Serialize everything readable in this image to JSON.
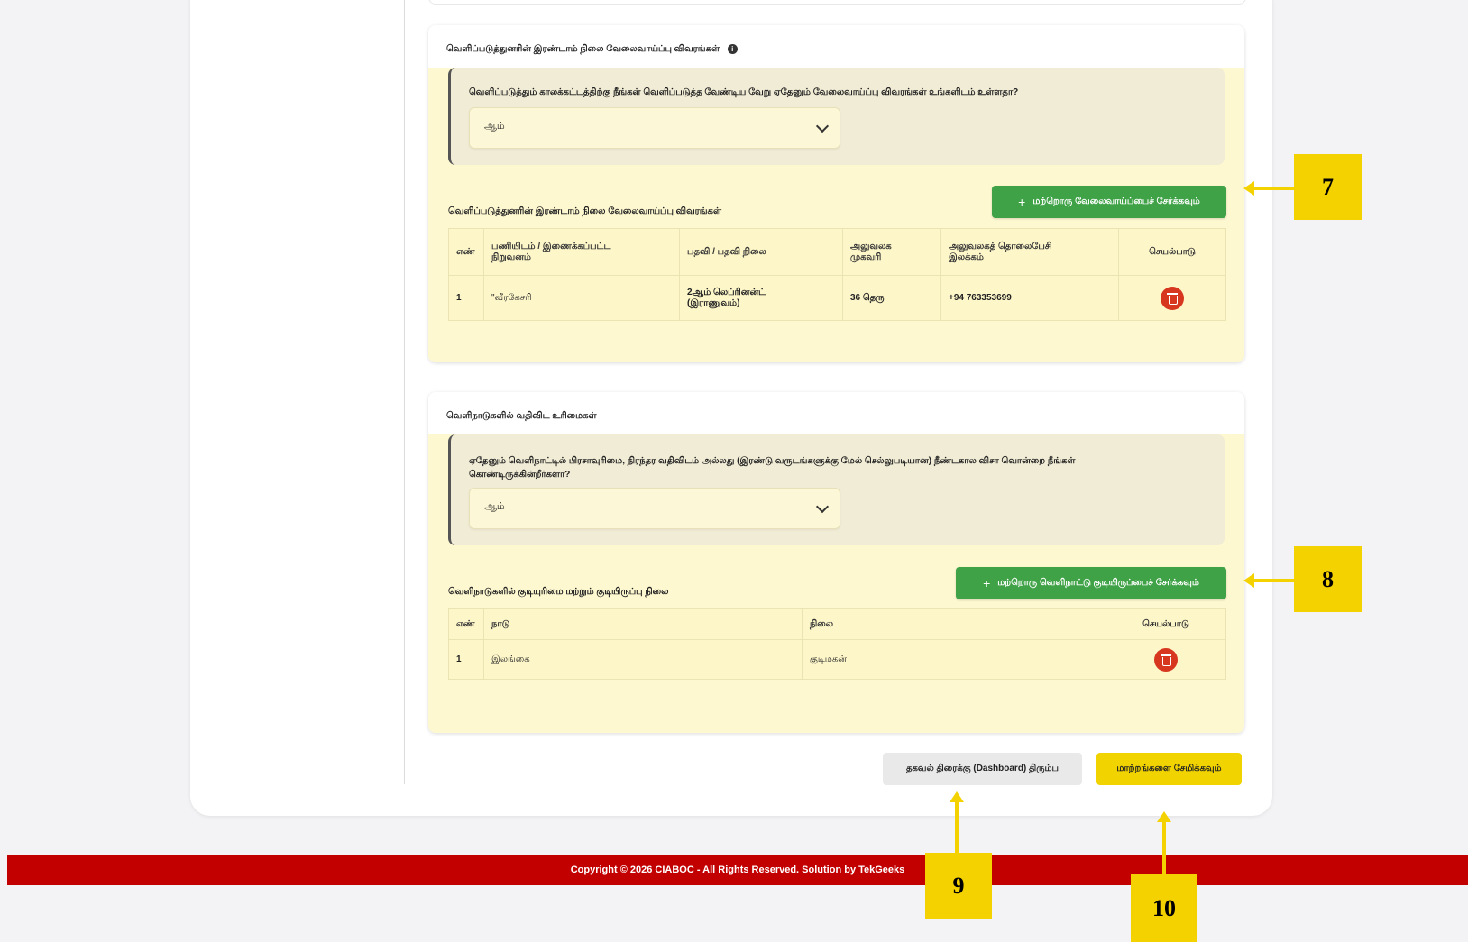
{
  "section1": {
    "title": "வெளிப்படுத்துனரின் இரண்டாம் நிலை வேலைவாய்ப்பு விவரங்கள்",
    "question": "வெளிப்படுத்தும் காலக்கட்டத்திற்கு நீங்கள் வெளிப்படுத்த வேண்டிய வேறு ஏதேனும் வேலைவாய்ப்பு விவரங்கள் உங்களிடம் உள்ளதா?",
    "select_value": "ஆம்",
    "add_button": "மற்றொரு வேலைவாய்ப்பைச் சேர்க்கவும்",
    "table_label": "வெளிப்படுத்துனரின் இரண்டாம் நிலை வேலைவாய்ப்பு விவரங்கள்",
    "headers": {
      "no": "எண்",
      "workplace_line1": "பணியிடம் / இணைக்கப்பட்ட",
      "workplace_line2": "நிறுவனம்",
      "position": "பதவி / பதவி நிலை",
      "address_line1": "அலுவலக",
      "address_line2": "முகவரி",
      "phone_line1": "அலுவலகத் தொலைபேசி",
      "phone_line2": "இலக்கம்",
      "action": "செயல்பாடு"
    },
    "rows": [
      {
        "no": "1",
        "workplace": "\"வீரகேசரி",
        "position_line1": "2ஆம் லெப்ரினன்ட்",
        "position_line2": "(இராணுவம்)",
        "address": "36 தெரு",
        "phone": "+94 763353699"
      }
    ]
  },
  "section2": {
    "title": "வெளிநாடுகளில் வதிவிட உரிமைகள்",
    "question_line1": "ஏதேனும் வெளிநாட்டில் பிரசாவுரிமை, நிரந்தர வதிவிடம் அல்லது (இரண்டு வருடங்களுக்கு மேல் செல்லுபடியான) நீண்டகால விசா வொன்றை நீங்கள்",
    "question_line2": "கொண்டிருக்கின்றீர்களா?",
    "select_value": "ஆம்",
    "add_button": "மற்றொரு வெளிநாட்டு குடியிருப்பைச் சேர்க்கவும்",
    "table_label": "வெளிநாடுகளில் குடியுரிமை மற்றும் குடியிருப்பு நிலை",
    "headers": {
      "no": "எண்",
      "country": "நாடு",
      "status": "நிலை",
      "action": "செயல்பாடு"
    },
    "rows": [
      {
        "no": "1",
        "country": "இலங்கை",
        "status": "குடிமகன்"
      }
    ]
  },
  "buttons": {
    "dashboard": "தகவல் திரைக்கு (Dashboard) திரும்ப",
    "save": "மாற்றங்களை சேமிக்கவும்"
  },
  "footer": "Copyright © 2026 CIABOC - All Rights Reserved. Solution by TekGeeks",
  "callouts": {
    "c7": "7",
    "c8": "8",
    "c9": "9",
    "c10": "10"
  },
  "icons": {
    "info": "info-icon",
    "trash": "trash-icon",
    "chevron": "chevron-down-icon",
    "plus": "plus-icon"
  },
  "colors": {
    "primary_green": "#3fa247",
    "save_yellow": "#f1d300",
    "footer_red": "#c30000",
    "delete_red": "#d7361f",
    "callout_yellow": "#f4d200"
  }
}
